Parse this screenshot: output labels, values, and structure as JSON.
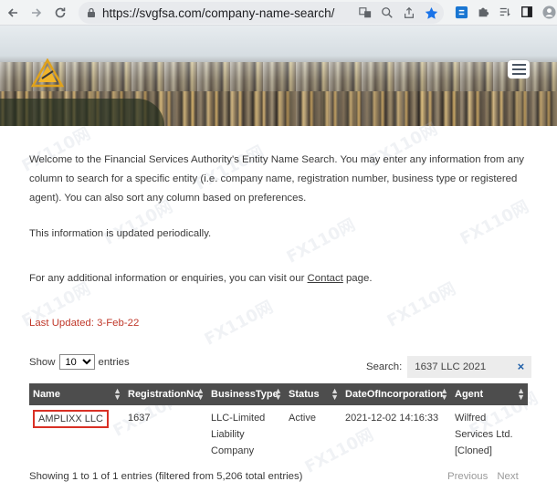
{
  "browser": {
    "url": "https://svgfsa.com/company-name-search/"
  },
  "intro": {
    "text": "Welcome to the Financial Services Authority's Entity Name Search. You may enter any information from any column to search for a specific entity (i.e. company name, registration number, business type or registered agent). You can also sort any column based on preferences.",
    "updated": "This information is updated periodically.",
    "contact_prefix": "For any additional information or enquiries, you can visit our ",
    "contact_link": "Contact",
    "contact_suffix": " page."
  },
  "last_updated": "Last Updated:  3-Feb-22",
  "table_controls": {
    "show_label": "Show",
    "entries_value": "10",
    "entries_label": "entries",
    "search_label": "Search:",
    "search_value": "1637 LLC 2021",
    "clear_glyph": "×"
  },
  "table": {
    "headers": [
      "Name",
      "RegistrationNo",
      "BusinessType",
      "Status",
      "DateOfIncorporation",
      "Agent"
    ],
    "rows": [
      {
        "name": "AMPLIXX LLC",
        "registration_no": "1637",
        "business_type": "LLC-Limited Liability Company",
        "status": "Active",
        "date": "2021-12-02 14:16:33",
        "agent": "Wilfred Services Ltd. [Cloned]"
      }
    ]
  },
  "info_text": "Showing 1 to 1 of 1 entries (filtered from 5,206 total entries)",
  "pagination": {
    "previous": "Previous",
    "next": "Next"
  },
  "watermark": "FX110网",
  "colors": {
    "header_bg": "#4d4d4d",
    "last_updated": "#c0392b",
    "highlight_border": "#d93025"
  }
}
